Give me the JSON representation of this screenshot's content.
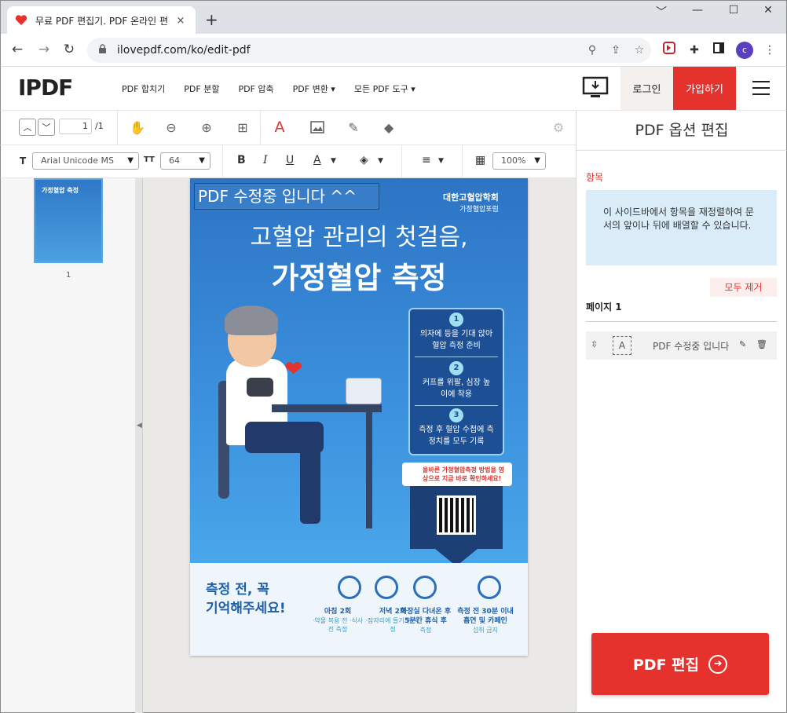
{
  "browser": {
    "tab_title": "무료 PDF 편집기. PDF 온라인 편",
    "tab_close": "×",
    "new_tab": "+",
    "url": "ilovepdf.com/ko/edit-pdf",
    "avatar_letter": "c",
    "window_controls": [
      "﹀",
      "—",
      "☐",
      "✕"
    ]
  },
  "site": {
    "logo_left": "I",
    "logo_right": "PDF",
    "nav": [
      "PDF 합치기",
      "PDF 분할",
      "PDF 압축",
      "PDF 변환 ▾",
      "모든 PDF 도구 ▾"
    ],
    "login": "로그인",
    "signup": "가입하기",
    "brand_color": "#e5322d"
  },
  "toolbar": {
    "page_current": "1",
    "page_total": "/1",
    "font_name": "Arial Unicode MS",
    "font_size": "64",
    "opacity": "100%",
    "bold": "B",
    "italic": "I",
    "underline": "U",
    "text_label": "T",
    "size_label": "TT",
    "text_tool": "A",
    "color_tool": "A"
  },
  "thumbnails": {
    "title_snippet": "가정혈압 측정",
    "page_number": "1"
  },
  "poster": {
    "edited_text": "PDF 수정중 입니다 ^^",
    "society": "대한고혈압학회",
    "society_sub": "가정혈압포럼",
    "headline1": "고혈압 관리의 첫걸음,",
    "headline2": "가정혈압 측정",
    "steps": [
      {
        "num": "1",
        "text": "의자에 등을 기대 앉아 혈압 측정 준비"
      },
      {
        "num": "2",
        "text": "커프를 위팔, 심장 높이에 착용"
      },
      {
        "num": "3",
        "text": "측정 후 혈압 수첩에 측정치를 모두 기록"
      }
    ],
    "qr_banner": "올바른 가정혈압측정 방법을 영상으로 지금 바로 확인하세요!",
    "remember1": "측정 전, 꼭",
    "remember2": "기억해주세요!",
    "tips": [
      {
        "title": "아침 2회",
        "sub": "·약물 복용 전 ·식사 전 측정"
      },
      {
        "title": "저녁 2회",
        "sub": "·잠자리에 들기 전 측정"
      },
      {
        "title": "화장실 다녀온 후 5분간 휴식 후",
        "sub": "측정"
      },
      {
        "title": "측정 전 30분 이내 흡연 및 카페인",
        "sub": "섭취 금지"
      }
    ]
  },
  "panel": {
    "title": "PDF 옵션 편집",
    "section": "항목",
    "info": "이 사이드바에서 항목을 재정렬하여 문서의 앞이나 뒤에 배열할 수 있습니다.",
    "clear_all": "모두 제거",
    "page_label": "페이지 1",
    "item_label": "PDF 수정중 입니다 ^^",
    "item_icon": "A",
    "submit": "PDF 편집",
    "submit_icon": "➜"
  }
}
